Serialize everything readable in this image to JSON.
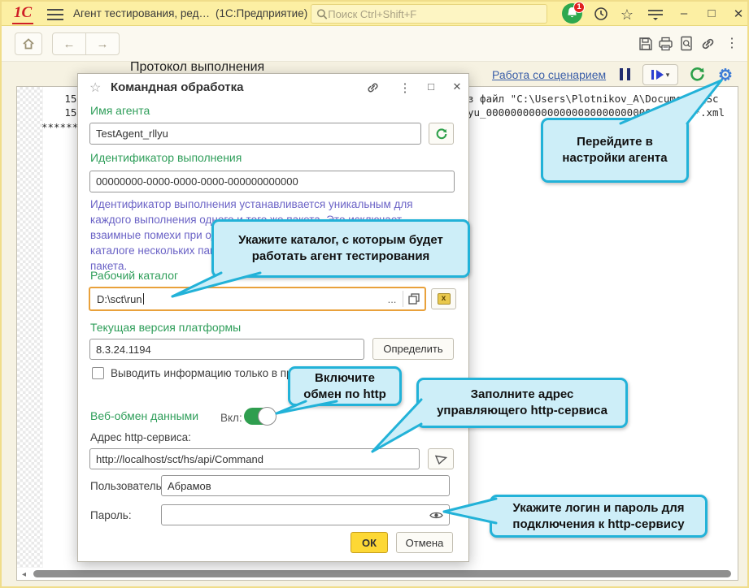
{
  "colors": {
    "accent_green": "#2f9e5a",
    "callout_border": "#22b2d8",
    "callout_fill": "#cdeef8",
    "ok_yellow": "#fdd835",
    "focus_orange": "#e9a13b",
    "link_blue": "#3a5ea8",
    "gear_blue": "#3e7cd6",
    "description_purple": "#6b63c6"
  },
  "glyphs": {
    "star_outline": "☆",
    "kebab": "⋮",
    "minimize": "–",
    "maximize": "□",
    "close": "✕",
    "back": "←",
    "forward": "→",
    "ellipsis": "...",
    "caret_down": "▾",
    "gear": "⚙",
    "scroll_left": "◂"
  },
  "window": {
    "titlebar": {
      "logo": "1С",
      "app_title": "Агент тестирования, ред…",
      "app_suffix": "(1С:Предприятие)",
      "search_placeholder": "Поиск Ctrl+Shift+F",
      "notification_count": "1"
    },
    "toolbar": {
      "page_title": "Протокол выполнения"
    },
    "scenario_bar": {
      "link": "Работа со сценарием"
    },
    "log": {
      "left_lines": [
        "15:02",
        "15:02",
        "********"
      ],
      "right_lines": [
        "з файл \"C:\\Users\\Plotnikov_A\\Documents\\Sc",
        "yu_0000000000000000000000000000000000*.xml"
      ]
    }
  },
  "dialog": {
    "title": "Командная обработка",
    "agent_name": {
      "label": "Имя агента",
      "value": "TestAgent_rllyu"
    },
    "run_id": {
      "label": "Идентификатор выполнения",
      "value": "00000000-0000-0000-0000-000000000000"
    },
    "description_lines": [
      "Идентификатор выполнения устанавливается уникальным для",
      "каждого выполнения одного и того же пакета. Это исключает",
      "взаимные помехи при од",
      "каталоге нескольких пак",
      "пакета."
    ],
    "work_dir": {
      "label": "Рабочий каталог",
      "value": "D:\\sct\\run",
      "ellipsis": "..."
    },
    "platform": {
      "label": "Текущая версия платформы",
      "value": "8.3.24.1194",
      "detect_button": "Определить"
    },
    "checkbox_label": "Выводить информацию только в прот",
    "web_exchange": {
      "label": "Веб-обмен данными",
      "state_label": "Вкл:"
    },
    "http_address": {
      "label": "Адрес http-сервиса:",
      "value": "http://localhost/sct/hs/api/Command"
    },
    "user": {
      "label": "Пользователь:",
      "value": "Абрамов"
    },
    "password": {
      "label": "Пароль:",
      "value": ""
    },
    "ok_button": "ОК",
    "cancel_button": "Отмена"
  },
  "callouts": {
    "settings": "Перейдите в настройки агента",
    "workdir": "Укажите каталог, с которым будет работать агент тестирования",
    "http_enable": "Включите обмен по http",
    "http_address": "Заполните адрес управляющего http-сервиса",
    "credentials": "Укажите логин и пароль для подключения  к http-сервису"
  }
}
